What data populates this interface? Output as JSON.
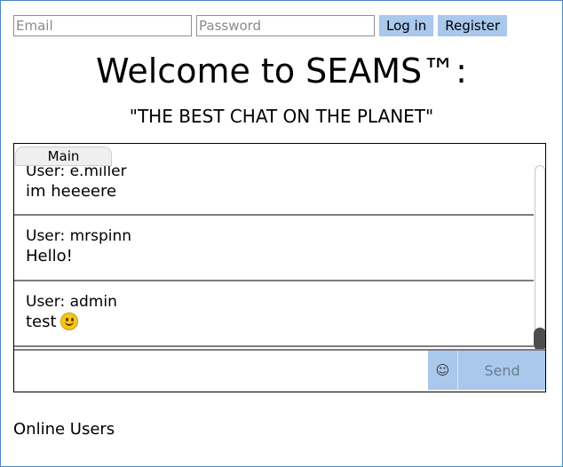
{
  "auth": {
    "email_placeholder": "Email",
    "password_placeholder": "Password",
    "login_label": "Log in",
    "register_label": "Register"
  },
  "header": {
    "title": "Welcome to SEAMS™:",
    "subtitle": "\"THE BEST CHAT ON THE PLANET\""
  },
  "chat": {
    "tab_label": "Main",
    "messages": [
      {
        "user": "User: e.miller",
        "text": "im heeeere"
      },
      {
        "user": "User: mrspinn",
        "text": "Hello!"
      },
      {
        "user": "User: admin",
        "text": "test",
        "emoji": "slightly-smiling-face-icon"
      }
    ],
    "scroll_fraction": 1.0,
    "emoji_button_label": "☺",
    "send_label": "Send"
  },
  "online": {
    "heading": "Online Users"
  },
  "colors": {
    "accent": "#a9c8ec",
    "border": "#4a86c8",
    "divider": "#7d7d7d"
  }
}
